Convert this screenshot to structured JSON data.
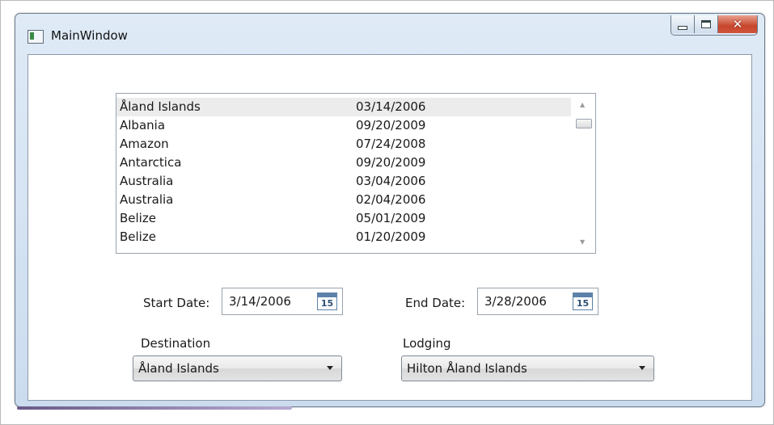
{
  "window": {
    "title": "MainWindow"
  },
  "list": {
    "rows": [
      {
        "country": "Åland Islands",
        "date": "03/14/2006",
        "selected": true
      },
      {
        "country": "Albania",
        "date": "09/20/2009"
      },
      {
        "country": "Amazon",
        "date": "07/24/2008"
      },
      {
        "country": "Antarctica",
        "date": "09/20/2009"
      },
      {
        "country": "Australia",
        "date": "03/04/2006"
      },
      {
        "country": "Australia",
        "date": "02/04/2006"
      },
      {
        "country": "Belize",
        "date": "05/01/2009"
      },
      {
        "country": "Belize",
        "date": "01/20/2009"
      }
    ]
  },
  "start_date": {
    "label": "Start Date:",
    "value": "3/14/2006",
    "calendar_day": "15"
  },
  "end_date": {
    "label": "End Date:",
    "value": "3/28/2006",
    "calendar_day": "15"
  },
  "destination": {
    "label": "Destination",
    "selected": "Åland Islands"
  },
  "lodging": {
    "label": "Lodging",
    "selected": "Hilton Åland Islands"
  },
  "icons": {
    "scroll_up": "▲",
    "scroll_down": "▼",
    "close": "✕"
  },
  "colors": {
    "close_button": "#c7452c",
    "title_bar": "#cbdcef",
    "selected_row": "#ececec"
  }
}
